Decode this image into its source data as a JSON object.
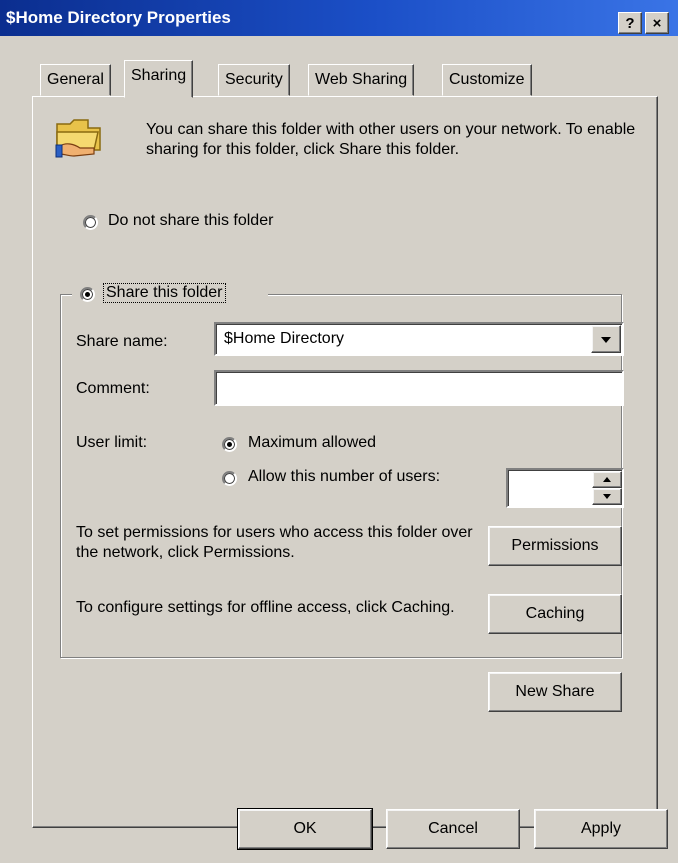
{
  "window": {
    "title": "$Home Directory Properties",
    "help_label": "?",
    "close_label": "×"
  },
  "tabs": [
    {
      "label": "General"
    },
    {
      "label": "Sharing"
    },
    {
      "label": "Security"
    },
    {
      "label": "Web Sharing"
    },
    {
      "label": "Customize"
    }
  ],
  "sharing": {
    "description": "You can share this folder with other users on your network.  To enable sharing for this folder, click Share this folder.",
    "do_not_share": "Do not share this folder",
    "share": "Share this folder",
    "share_name_label": "Share name:",
    "share_name_value": "$Home Directory",
    "comment_label": "Comment:",
    "comment_value": "",
    "user_limit_label": "User limit:",
    "max_allowed": "Maximum allowed",
    "allow_number": "Allow this number of users:",
    "users_value": "",
    "permissions_text": "To set permissions for users who access this folder over the network, click Permissions.",
    "permissions_button": "Permissions",
    "caching_text": "To configure settings for offline access, click Caching.",
    "caching_button": "Caching",
    "new_share_button": "New Share"
  },
  "footer": {
    "ok": "OK",
    "cancel": "Cancel",
    "apply": "Apply"
  }
}
